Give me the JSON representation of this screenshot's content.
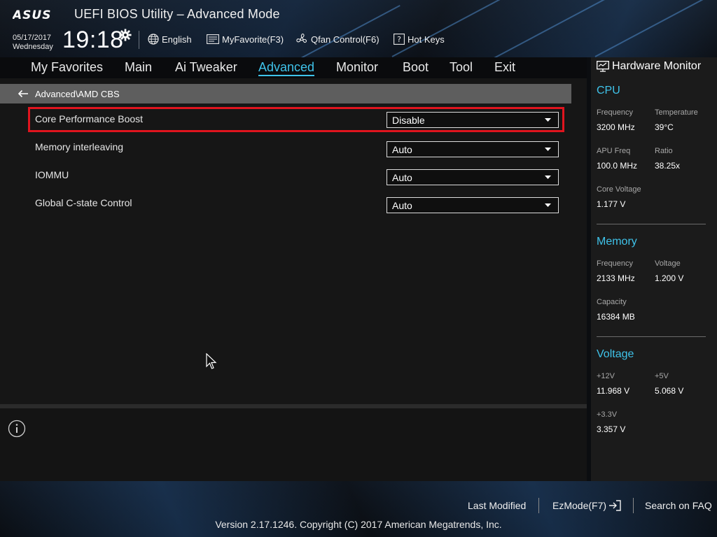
{
  "header": {
    "brand": "ASUS",
    "title": "UEFI BIOS Utility – Advanced Mode",
    "date": "05/17/2017",
    "weekday": "Wednesday",
    "time": "19:18",
    "items": {
      "language": "English",
      "favorite": "MyFavorite(F3)",
      "qfan": "Qfan Control(F6)",
      "hotkeys": "Hot Keys"
    }
  },
  "nav": {
    "tabs": [
      "My Favorites",
      "Main",
      "Ai Tweaker",
      "Advanced",
      "Monitor",
      "Boot",
      "Tool",
      "Exit"
    ],
    "active": "Advanced"
  },
  "breadcrumb": "Advanced\\AMD CBS",
  "settings": [
    {
      "label": "Core Performance Boost",
      "value": "Disable",
      "selected": true
    },
    {
      "label": "Memory interleaving",
      "value": "Auto"
    },
    {
      "label": "IOMMU",
      "value": "Auto"
    },
    {
      "label": "Global C-state Control",
      "value": "Auto"
    }
  ],
  "hwmon": {
    "title": "Hardware Monitor",
    "cpu": {
      "heading": "CPU",
      "frequency_label": "Frequency",
      "frequency": "3200 MHz",
      "temperature_label": "Temperature",
      "temperature": "39°C",
      "apu_label": "APU Freq",
      "apu": "100.0 MHz",
      "ratio_label": "Ratio",
      "ratio": "38.25x",
      "vcore_label": "Core Voltage",
      "vcore": "1.177 V"
    },
    "memory": {
      "heading": "Memory",
      "frequency_label": "Frequency",
      "frequency": "2133 MHz",
      "voltage_label": "Voltage",
      "voltage": "1.200 V",
      "capacity_label": "Capacity",
      "capacity": "16384 MB"
    },
    "voltage": {
      "heading": "Voltage",
      "v12_label": "+12V",
      "v12": "11.968 V",
      "v5_label": "+5V",
      "v5": "5.068 V",
      "v33_label": "+3.3V",
      "v33": "3.357 V"
    }
  },
  "footer": {
    "last_modified": "Last Modified",
    "ezmode": "EzMode(F7)",
    "faq": "Search on FAQ",
    "copyright": "Version 2.17.1246. Copyright (C) 2017 American Megatrends, Inc."
  },
  "colors": {
    "accent": "#3fc3ea",
    "highlight": "#e0141e"
  }
}
